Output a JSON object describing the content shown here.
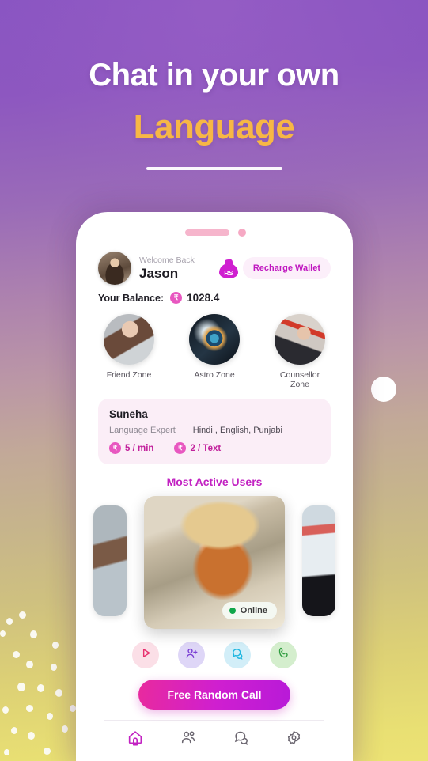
{
  "hero": {
    "line1": "Chat in your own",
    "line2": "Language"
  },
  "phone": {
    "header": {
      "welcome_label": "Welcome Back",
      "user_name": "Jason",
      "wallet_icon_text": "RS",
      "recharge_label": "Recharge Wallet",
      "balance_label": "Your Balance:",
      "currency_symbol": "₹",
      "balance_amount": "1028.4"
    },
    "zones": [
      {
        "label": "Friend Zone"
      },
      {
        "label": "Astro Zone"
      },
      {
        "label": "Counsellor Zone"
      }
    ],
    "expert": {
      "name": "Suneha",
      "role": "Language Expert",
      "languages": "Hindi , English, Punjabi",
      "price_call": "5 / min",
      "price_text": "2 / Text",
      "currency_symbol": "₹"
    },
    "carousel": {
      "title": "Most Active Users",
      "status_label": "Online"
    },
    "actions": [
      {
        "name": "video-call",
        "icon": "play-icon"
      },
      {
        "name": "add-friend",
        "icon": "add-person-icon"
      },
      {
        "name": "message",
        "icon": "chat-icon"
      },
      {
        "name": "voice-call",
        "icon": "phone-icon"
      }
    ],
    "cta_label": "Free Random Call",
    "nav": [
      {
        "name": "home",
        "active": true
      },
      {
        "name": "people",
        "active": false
      },
      {
        "name": "chat",
        "active": false
      },
      {
        "name": "settings",
        "active": false
      }
    ]
  },
  "colors": {
    "accent_magenta": "#c222c2",
    "accent_pink": "#e82a9e",
    "headline_yellow": "#f7b745",
    "online_green": "#0fa64a"
  }
}
